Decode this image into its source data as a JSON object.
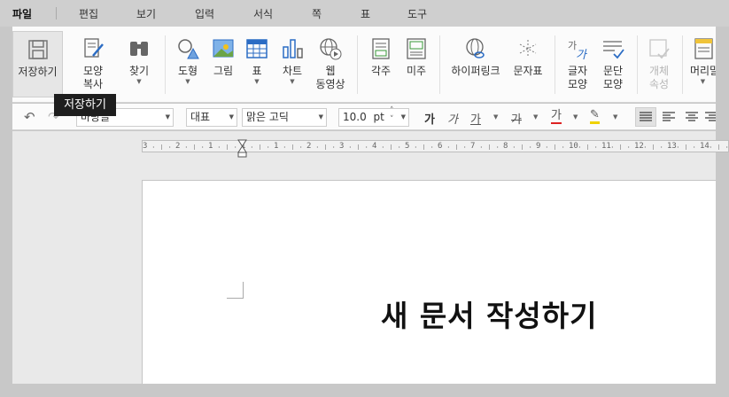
{
  "menu": {
    "items": [
      "파일",
      "편집",
      "보기",
      "입력",
      "서식",
      "쪽",
      "표",
      "도구"
    ]
  },
  "ribbon": {
    "save": "저장하기",
    "format_copy": [
      "모양",
      "복사"
    ],
    "find": "찾기",
    "shape": "도형",
    "picture": "그림",
    "table": "표",
    "chart": "차트",
    "web_video": [
      "웹",
      "동영상"
    ],
    "footnote": "각주",
    "endnote": "미주",
    "hyperlink": "하이퍼링크",
    "char_map": "문자표",
    "char_shape": [
      "글자",
      "모양"
    ],
    "para_shape": [
      "문단",
      "모양"
    ],
    "obj_props": [
      "개체",
      "속성"
    ],
    "header": "머리말"
  },
  "tooltip": "저장하기",
  "format": {
    "style_value": "바탕글",
    "lang_value": "대표",
    "font_value": "맑은 고딕",
    "size_value": "10.0",
    "size_unit": "pt",
    "bold_glyph": "가",
    "italic_glyph": "가",
    "underline_glyph": "가",
    "strike_glyph": "가",
    "color_glyph": "가"
  },
  "ruler": {
    "numbers": [
      "3",
      "2",
      "1",
      "1",
      "1",
      "2",
      "3",
      "4",
      "5",
      "6",
      "7",
      "8",
      "9",
      "10",
      "11",
      "12",
      "13",
      "14"
    ]
  },
  "document": {
    "title": "새 문서 작성하기"
  },
  "colors": {
    "accent_blue": "#2b6cc4",
    "underline_red": "#d22",
    "highlight_yellow": "#f0d200"
  }
}
